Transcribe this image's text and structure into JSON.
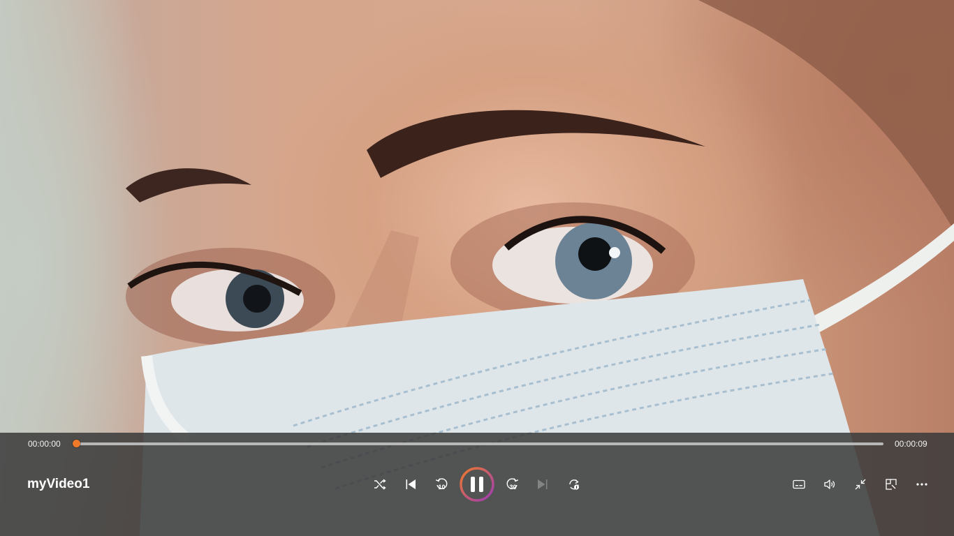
{
  "player": {
    "title": "myVideo1",
    "current_time": "00:00:00",
    "total_time": "00:00:09",
    "progress_fraction": 0.0,
    "state": "playing",
    "accent_color": "#f07a2a",
    "accent_gradient_end": "#9b3bb5"
  },
  "controls": {
    "center": [
      {
        "name": "shuffle-icon",
        "enabled": true
      },
      {
        "name": "previous-icon",
        "enabled": true
      },
      {
        "name": "skip-back-icon",
        "enabled": true
      },
      {
        "name": "pause-icon",
        "enabled": true
      },
      {
        "name": "skip-forward-icon",
        "enabled": true
      },
      {
        "name": "next-icon",
        "enabled": false
      },
      {
        "name": "repeat-one-icon",
        "enabled": true
      }
    ],
    "skip_back_label": "10",
    "skip_forward_label": "30",
    "right": [
      {
        "name": "subtitles-icon"
      },
      {
        "name": "volume-icon"
      },
      {
        "name": "exit-fullscreen-icon"
      },
      {
        "name": "mini-player-icon"
      },
      {
        "name": "more-options-icon"
      }
    ]
  }
}
